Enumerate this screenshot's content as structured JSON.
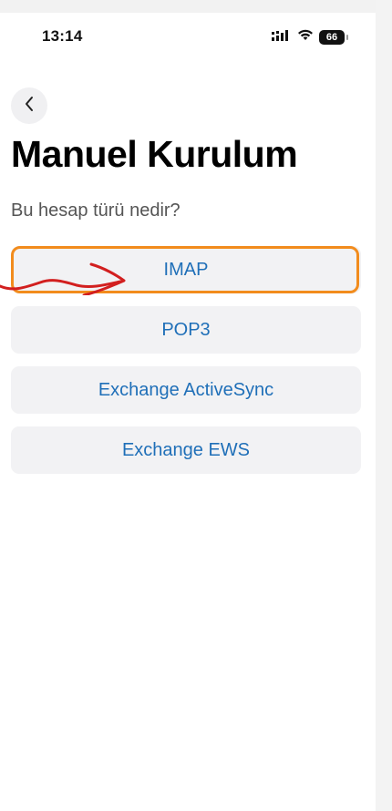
{
  "status_bar": {
    "time": "13:14",
    "battery": "66",
    "icons": [
      "cellular-signal-icon",
      "wifi-icon",
      "battery-icon"
    ]
  },
  "nav": {
    "back_icon": "chevron-left-icon"
  },
  "header": {
    "title": "Manuel Kurulum",
    "question": "Bu hesap türü nedir?"
  },
  "options": [
    {
      "label": "IMAP",
      "highlighted": true
    },
    {
      "label": "POP3",
      "highlighted": false
    },
    {
      "label": "Exchange ActiveSync",
      "highlighted": false
    },
    {
      "label": "Exchange EWS",
      "highlighted": false
    }
  ],
  "colors": {
    "link_blue": "#1f6fb8",
    "option_bg": "#f2f2f4",
    "highlight_orange": "#f28c1d",
    "annotation_red": "#d21f1f"
  }
}
